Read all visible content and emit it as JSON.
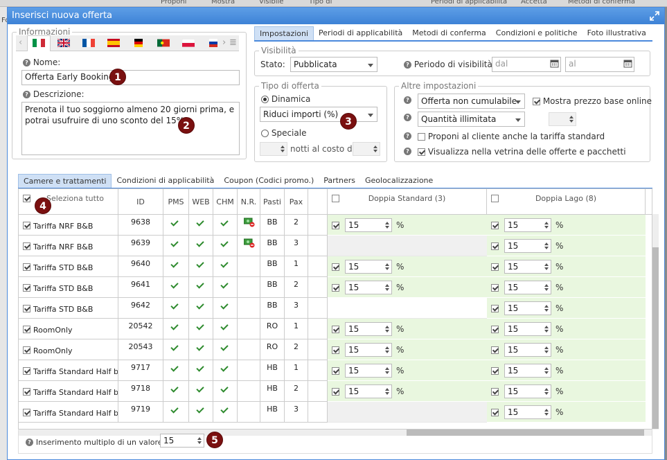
{
  "background": {
    "left_label": "Fo",
    "columns": [
      "Proponi",
      "Mostra",
      "Visibile",
      "Tipo di",
      "Periodi di applicabilità",
      "Accetta",
      "Metodi di conferma"
    ]
  },
  "dialog": {
    "title": "Inserisci nuova offerta"
  },
  "info": {
    "legend": "Informazioni",
    "name_label": "Nome:",
    "name_value": "Offerta Early Booking",
    "desc_label": "Descrizione:",
    "desc_value": "Prenota il tuo soggiorno almeno 20 giorni prima, e potrai usufruire di uno sconto del 15%!",
    "languages": [
      "it",
      "gb",
      "fr",
      "es",
      "de",
      "pt",
      "pl",
      "ru"
    ]
  },
  "top_tabs": [
    "Impostazioni",
    "Periodi di applicabilità",
    "Metodi di conferma",
    "Condizioni e politiche",
    "Foto illustrativa"
  ],
  "visibility": {
    "legend": "Visibilità",
    "state_label": "Stato:",
    "state_value": "Pubblicata",
    "period_label": "Periodo di visibilità:",
    "from_placeholder": "dal",
    "to_placeholder": "al"
  },
  "offer_type": {
    "legend": "Tipo di offerta",
    "dynamic_label": "Dinamica",
    "dynamic_select": "Riduci importi (%)",
    "special_label": "Speciale",
    "cost_label": "notti al costo di"
  },
  "other": {
    "legend": "Altre impostazioni",
    "cumulable_value": "Offerta non cumulabile",
    "show_base_price": "Mostra prezzo base online",
    "quantity_value": "Quantità illimitata",
    "propose_standard": "Proponi al cliente anche la tariffa standard",
    "show_showcase": "Visualizza nella vetrina delle offerte e pacchetti"
  },
  "bottom_tabs": [
    "Camere e trattamenti",
    "Condizioni di applicabilità",
    "Coupon (Codici promo.)",
    "Partners",
    "Geolocalizzazione"
  ],
  "grid": {
    "headers": {
      "select_all": "Seleziona tutto",
      "id": "ID",
      "pms": "PMS",
      "web": "WEB",
      "chm": "CHM",
      "nr": "N.R.",
      "pasti": "Pasti",
      "pax": "Pax"
    },
    "rooms": [
      "Doppia Standard (3)",
      "Doppia Lago (8)"
    ],
    "rows": [
      {
        "name": "Tariffa NRF B&B",
        "id": "9638",
        "pms": true,
        "web": true,
        "chm": true,
        "nr": true,
        "pasti": "BB",
        "pax": "2",
        "room1": "15",
        "room2": "15"
      },
      {
        "name": "Tariffa NRF B&B",
        "id": "9639",
        "pms": true,
        "web": true,
        "chm": true,
        "nr": true,
        "pasti": "BB",
        "pax": "3",
        "room1": null,
        "room2": "15"
      },
      {
        "name": "Tariffa STD B&B",
        "id": "9640",
        "pms": true,
        "web": true,
        "chm": true,
        "nr": false,
        "pasti": "BB",
        "pax": "1",
        "room1": "15",
        "room2": "15"
      },
      {
        "name": "Tariffa STD B&B",
        "id": "9641",
        "pms": true,
        "web": true,
        "chm": true,
        "nr": false,
        "pasti": "BB",
        "pax": "2",
        "room1": "15",
        "room2": "15"
      },
      {
        "name": "Tariffa STD B&B",
        "id": "9642",
        "pms": true,
        "web": true,
        "chm": true,
        "nr": false,
        "pasti": "BB",
        "pax": "3",
        "room1": null,
        "room2": "15"
      },
      {
        "name": "RoomOnly",
        "id": "20542",
        "pms": true,
        "web": true,
        "chm": true,
        "nr": false,
        "pasti": "RO",
        "pax": "1",
        "room1": "15",
        "room2": "15"
      },
      {
        "name": "RoomOnly",
        "id": "20543",
        "pms": true,
        "web": true,
        "chm": true,
        "nr": false,
        "pasti": "RO",
        "pax": "2",
        "room1": "15",
        "room2": "15"
      },
      {
        "name": "Tariffa Standard Half boa",
        "id": "9717",
        "pms": true,
        "web": true,
        "chm": true,
        "nr": false,
        "pasti": "HB",
        "pax": "1",
        "room1": "15",
        "room2": "15"
      },
      {
        "name": "Tariffa Standard Half boa",
        "id": "9718",
        "pms": true,
        "web": true,
        "chm": true,
        "nr": false,
        "pasti": "HB",
        "pax": "2",
        "room1": "15",
        "room2": "15"
      },
      {
        "name": "Tariffa Standard Half boa",
        "id": "9719",
        "pms": true,
        "web": true,
        "chm": true,
        "nr": false,
        "pasti": "HB",
        "pax": "3",
        "room1": null,
        "room2": "15"
      }
    ],
    "percent_symbol": "%"
  },
  "multi": {
    "label": "Inserimento multiplo di un valore",
    "value": "15"
  },
  "badges": [
    "1",
    "2",
    "3",
    "4",
    "5"
  ],
  "colors": {
    "accent": "#4a89dc",
    "green_row": "#e9f7df",
    "badge": "#7a1010",
    "check_green": "#2e8b2e"
  }
}
